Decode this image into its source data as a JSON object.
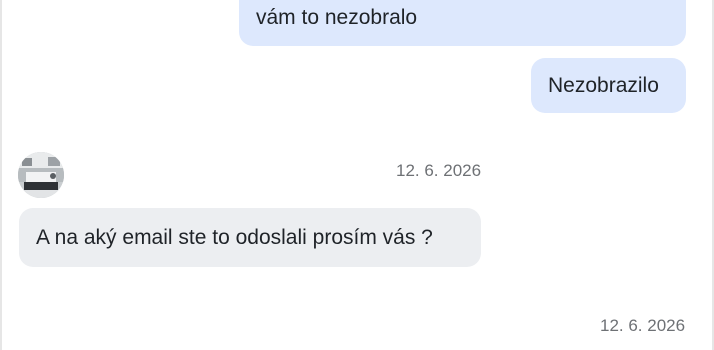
{
  "messages": [
    {
      "direction": "outgoing",
      "text_partial_top": "... ... ... ...",
      "text": "vám to nezobralo"
    },
    {
      "direction": "outgoing",
      "text": "Nezobrazilo"
    },
    {
      "direction": "incoming",
      "timestamp": "12. 6. 2026",
      "text": "A na aký email ste to odoslali prosím vás ?"
    }
  ],
  "footer_timestamp": "12. 6. 2026",
  "avatar": {
    "icon": "contact-avatar-photo"
  },
  "colors": {
    "outgoing_bubble": "#dde8fd",
    "incoming_bubble": "#eceef1",
    "timestamp_text": "#6e7175"
  }
}
